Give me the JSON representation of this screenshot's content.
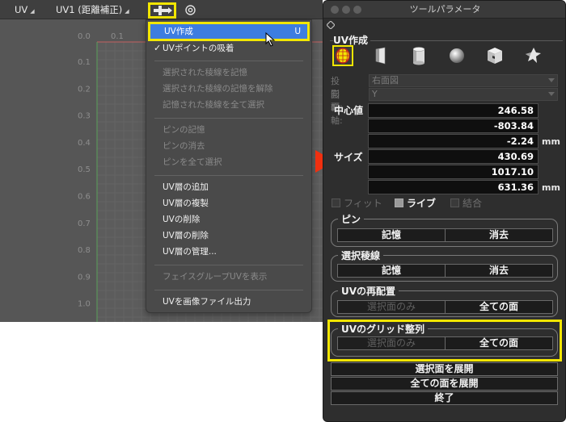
{
  "uv_view": {
    "tabs": [
      {
        "label": "UV"
      },
      {
        "label": "UV1 (距離補正)"
      }
    ],
    "grid": {
      "x_labels": [
        "0.0",
        "0.1"
      ],
      "y_labels": [
        "0.1",
        "0.2",
        "0.3",
        "0.4",
        "0.5",
        "0.6",
        "0.7",
        "0.8",
        "0.9",
        "1.0"
      ]
    },
    "menu": {
      "items": [
        {
          "label": "UV作成",
          "shortcut": "U",
          "state": "highlighted"
        },
        {
          "label": "UVポイントの吸着",
          "checked": true,
          "state": "enabled"
        },
        {
          "label": "選択された稜線を記憶",
          "state": "disabled"
        },
        {
          "label": "選択された稜線の記憶を解除",
          "state": "disabled"
        },
        {
          "label": "記憶された稜線を全て選択",
          "state": "disabled"
        },
        {
          "label": "ピンの記憶",
          "state": "disabled"
        },
        {
          "label": "ピンの消去",
          "state": "disabled"
        },
        {
          "label": "ピンを全て選択",
          "state": "disabled"
        },
        {
          "label": "UV層の追加",
          "state": "enabled"
        },
        {
          "label": "UV層の複製",
          "state": "enabled"
        },
        {
          "label": "UVの削除",
          "state": "enabled"
        },
        {
          "label": "UV層の削除",
          "state": "enabled"
        },
        {
          "label": "UV層の管理...",
          "state": "enabled"
        },
        {
          "label": "フェイスグループUVを表示",
          "state": "disabled"
        },
        {
          "label": "UVを画像ファイル出力",
          "state": "enabled"
        }
      ]
    }
  },
  "panel": {
    "title": "ツールパラメータ",
    "section_title": "UV作成",
    "shapes": [
      "sphere-poly-icon",
      "plane-icon",
      "cylinder-icon",
      "sphere-icon",
      "box-icon",
      "custom-shape-icon"
    ],
    "projection": {
      "label": "投影面:",
      "value": "右面図"
    },
    "rotation_axis": {
      "label": "回転軸:",
      "value": "Y"
    },
    "center": {
      "label": "中心値",
      "values": [
        "246.58",
        "-803.84",
        "-2.24"
      ],
      "unit": "mm"
    },
    "size": {
      "label": "サイズ",
      "values": [
        "430.69",
        "1017.10",
        "631.36"
      ],
      "unit": "mm"
    },
    "options": [
      {
        "label": "フィット",
        "checked": false,
        "enabled": false
      },
      {
        "label": "ライブ",
        "checked": true,
        "enabled": true
      },
      {
        "label": "結合",
        "checked": false,
        "enabled": false
      }
    ],
    "pin_group": {
      "title": "ピン",
      "buttons": [
        "記憶",
        "消去"
      ]
    },
    "edge_group": {
      "title": "選択稜線",
      "buttons": [
        "記憶",
        "消去"
      ]
    },
    "relayout_group": {
      "title": "UVの再配置",
      "buttons": [
        {
          "label": "選択面のみ",
          "enabled": false
        },
        {
          "label": "全ての面",
          "enabled": true
        }
      ]
    },
    "grid_group": {
      "title": "UVのグリッド整列",
      "buttons": [
        {
          "label": "選択面のみ",
          "enabled": false
        },
        {
          "label": "全ての面",
          "enabled": true
        }
      ]
    },
    "expand_selected": "選択面を展開",
    "expand_all": "全ての面を展開",
    "finish": "終了"
  },
  "colors": {
    "highlight_yellow": "#f2e600",
    "menu_selected": "#3d7de0",
    "arrow_red": "#f03010"
  }
}
